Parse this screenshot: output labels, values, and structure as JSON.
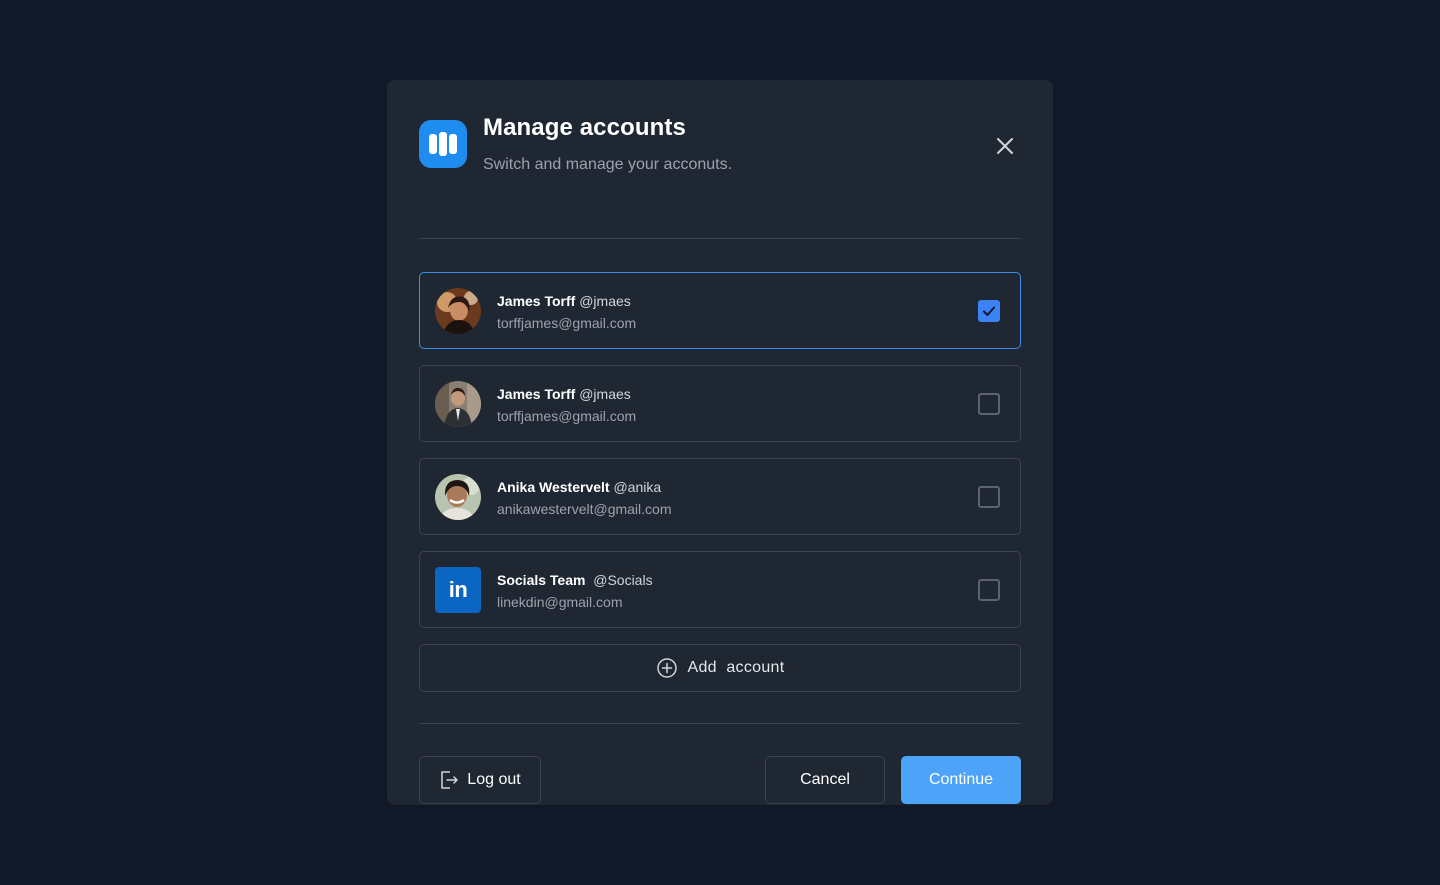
{
  "modal": {
    "title": "Manage accounts",
    "subtitle": "Switch and manage your acconuts."
  },
  "accounts": [
    {
      "name": "James Torff",
      "handle": "@jmaes",
      "email": "torffjames@gmail.com",
      "selected": true,
      "avatar": "photo-avatar"
    },
    {
      "name": "James Torff",
      "handle": "@jmaes",
      "email": "torffjames@gmail.com",
      "selected": false,
      "avatar": "photo-avatar"
    },
    {
      "name": "Anika Westervelt",
      "handle": "@anika",
      "email": "anikawestervelt@gmail.com",
      "selected": false,
      "avatar": "photo-avatar"
    },
    {
      "name": "Socials Team",
      "handle": "@Socials",
      "email": "linekdin@gmail.com",
      "selected": false,
      "avatar": "linkedin-logo",
      "logo_text": "in"
    }
  ],
  "add_account_label": "Add  account",
  "footer": {
    "logout_label": "Log out",
    "cancel_label": "Cancel",
    "continue_label": "Continue"
  },
  "colors": {
    "accent": "#4da3f7",
    "checkbox_checked": "#3b82f6",
    "app_logo": "#1f8cf0",
    "linkedin": "#0a66c2"
  },
  "icons": {
    "app": "app-logo-icon",
    "close": "close-icon",
    "check": "check-icon",
    "add": "plus-circle-icon",
    "logout": "logout-icon"
  }
}
